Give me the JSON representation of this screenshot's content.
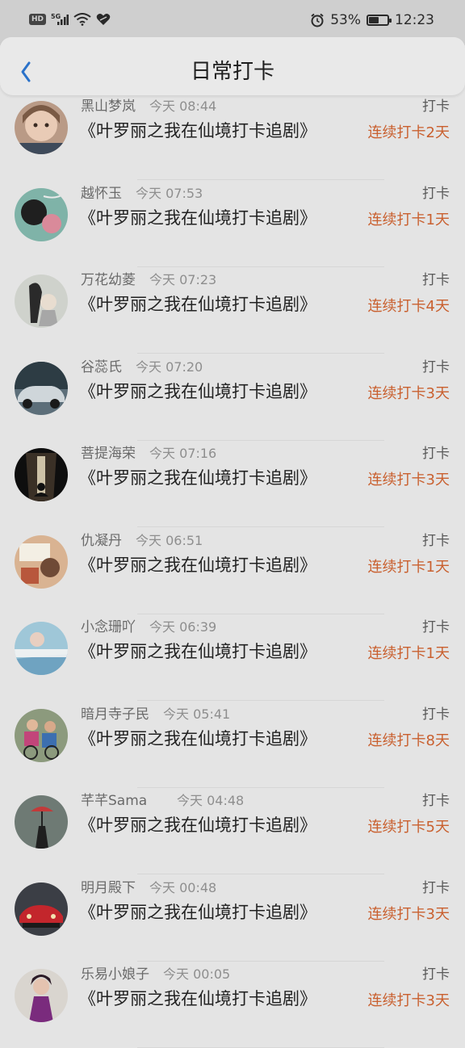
{
  "status_bar": {
    "left_badge": "HD",
    "network": "5G",
    "battery": "53%",
    "battery_level": 0.53,
    "time": "12:23"
  },
  "header": {
    "title": "日常打卡",
    "back_icon": "chevron-left-icon",
    "accent": "#2b72c9"
  },
  "colors": {
    "streak": "#c9602f",
    "background": "#e4e4e4"
  },
  "checkins": [
    {
      "name": "黑山梦岚",
      "time": "今天 08:44",
      "action": "打卡",
      "content": "《叶罗丽之我在仙境打卡追剧》",
      "streak": "连续打卡2天"
    },
    {
      "name": "越怀玉",
      "time": "今天 07:53",
      "action": "打卡",
      "content": "《叶罗丽之我在仙境打卡追剧》",
      "streak": "连续打卡1天"
    },
    {
      "name": "万花幼菱",
      "time": "今天 07:23",
      "action": "打卡",
      "content": "《叶罗丽之我在仙境打卡追剧》",
      "streak": "连续打卡4天"
    },
    {
      "name": "谷蕊氏",
      "time": "今天 07:20",
      "action": "打卡",
      "content": "《叶罗丽之我在仙境打卡追剧》",
      "streak": "连续打卡3天"
    },
    {
      "name": "菩提海荣",
      "time": "今天 07:16",
      "action": "打卡",
      "content": "《叶罗丽之我在仙境打卡追剧》",
      "streak": "连续打卡3天"
    },
    {
      "name": "仇凝丹",
      "time": "今天 06:51",
      "action": "打卡",
      "content": "《叶罗丽之我在仙境打卡追剧》",
      "streak": "连续打卡1天"
    },
    {
      "name": "小念珊吖",
      "time": "今天 06:39",
      "action": "打卡",
      "content": "《叶罗丽之我在仙境打卡追剧》",
      "streak": "连续打卡1天"
    },
    {
      "name": "暗月寺子民",
      "time": "今天 05:41",
      "action": "打卡",
      "content": "《叶罗丽之我在仙境打卡追剧》",
      "streak": "连续打卡8天"
    },
    {
      "name": "芊芊Sama",
      "time": "今天 04:48",
      "action": "打卡",
      "content": "《叶罗丽之我在仙境打卡追剧》",
      "streak": "连续打卡5天"
    },
    {
      "name": "明月殿下",
      "time": "今天 00:48",
      "action": "打卡",
      "content": "《叶罗丽之我在仙境打卡追剧》",
      "streak": "连续打卡3天"
    },
    {
      "name": "乐易小娘子",
      "time": "今天 00:05",
      "action": "打卡",
      "content": "《叶罗丽之我在仙境打卡追剧》",
      "streak": "连续打卡3天"
    }
  ]
}
